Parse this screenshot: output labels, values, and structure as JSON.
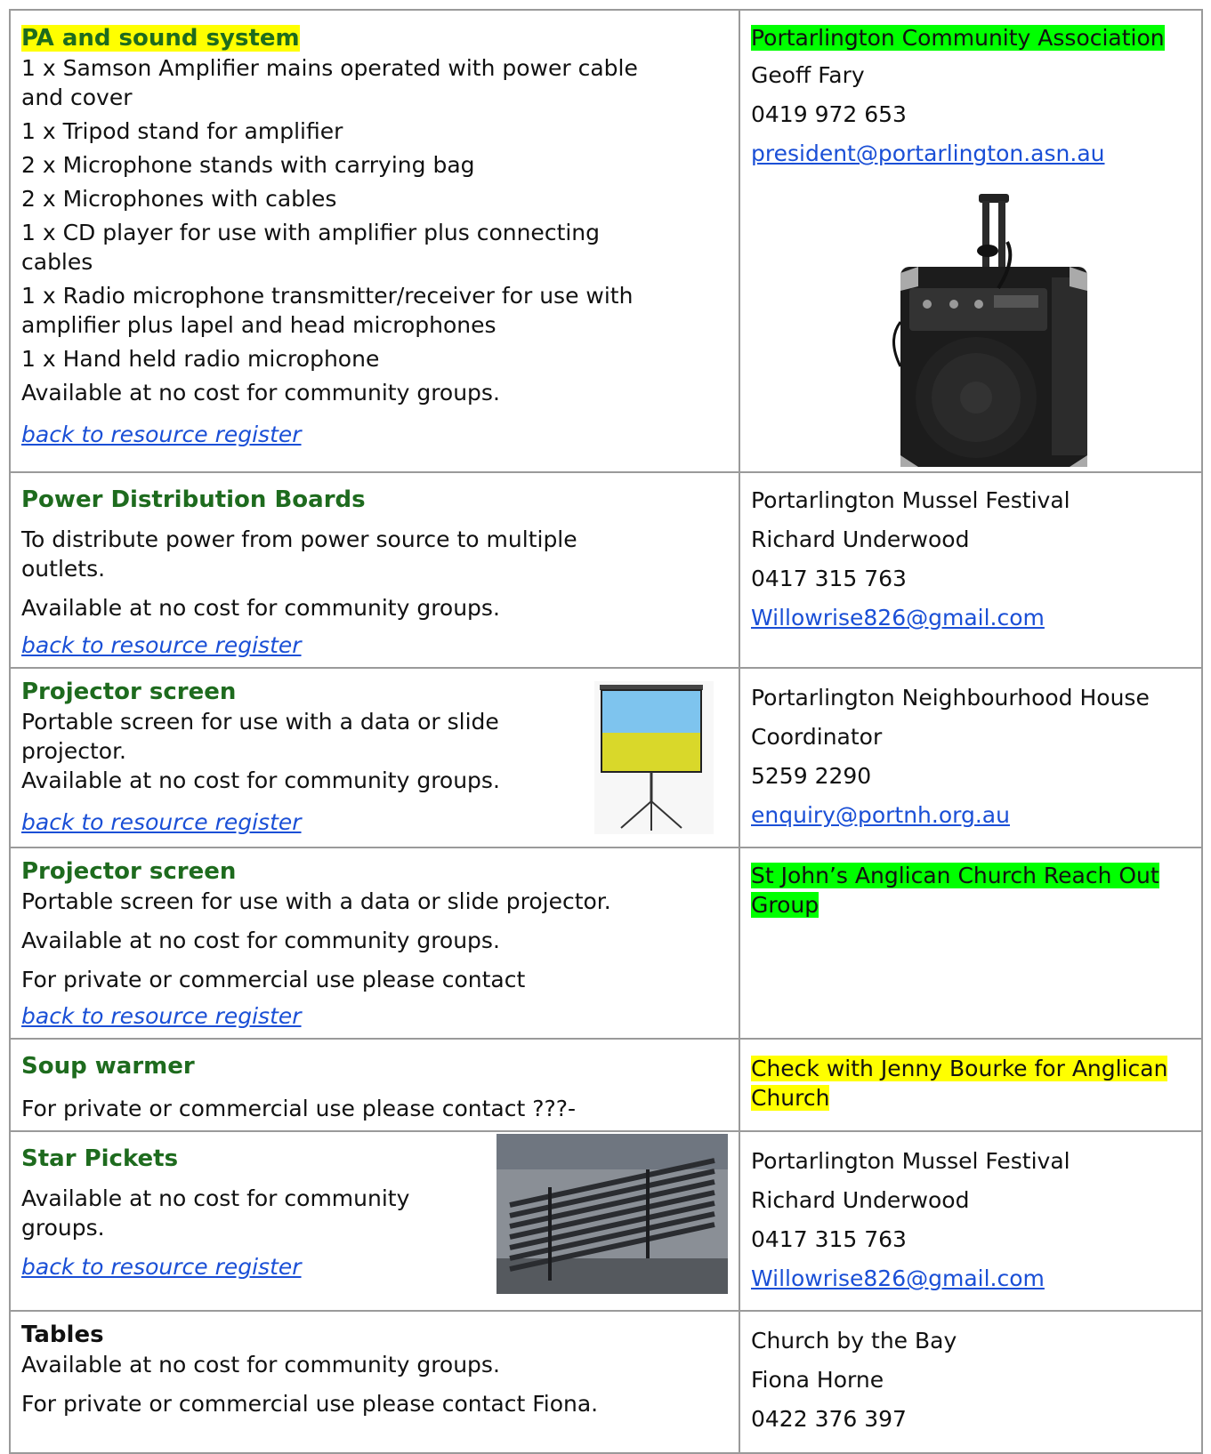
{
  "rows": [
    {
      "title": "PA and sound system",
      "lines": [
        "1 x Samson Amplifier mains operated with power cable and cover",
        "1 x Tripod stand for amplifier",
        "2 x Microphone stands with carrying bag",
        "2 x Microphones with cables",
        "1 x CD player for use with amplifier plus connecting cables",
        "1 x Radio microphone transmitter/receiver for use with amplifier plus lapel and head microphones",
        "1 x Hand held radio microphone",
        "Available at no cost for community groups."
      ],
      "link": "back to resource register",
      "org": "Portarlington Community Association",
      "contact": "Geoff Fary",
      "phone": "0419 972 653",
      "email": "president@portarlington.asn.au"
    },
    {
      "title": "Power Distribution Boards",
      "lines": [
        "To distribute power from power source to multiple outlets.",
        "Available at no cost for community groups."
      ],
      "link": "back to resource register",
      "org": "Portarlington Mussel Festival",
      "contact": "Richard Underwood",
      "phone": "0417 315 763",
      "email": "Willowrise826@gmail.com"
    },
    {
      "title": "Projector screen",
      "lines": [
        "Portable screen for use with a data or slide projector.",
        "Available at no cost for community groups."
      ],
      "link": "back to resource register",
      "org": "Portarlington Neighbourhood House",
      "contact": "Coordinator",
      "phone": "5259 2290",
      "email": "enquiry@portnh.org.au"
    },
    {
      "title": "Projector screen",
      "lines": [
        "Portable screen for use with a data or slide projector.",
        "Available at no cost for community groups.",
        "For private or commercial use please contact"
      ],
      "link": "back to resource register",
      "org": "St John’s Anglican Church Reach Out Group"
    },
    {
      "title": "Soup warmer",
      "lines": [
        "For private or commercial use please contact ???-"
      ],
      "org": "Check with Jenny Bourke for Anglican Church"
    },
    {
      "title": "Star Pickets",
      "lines": [
        "Available at no cost for community groups."
      ],
      "link": "back to resource register",
      "org": "Portarlington Mussel Festival",
      "contact": "Richard Underwood",
      "phone": "0417 315 763",
      "email": "Willowrise826@gmail.com"
    },
    {
      "title": "Tables",
      "lines": [
        "Available at no cost for community groups.",
        "For private or commercial use please contact Fiona."
      ],
      "org": "Church by the Bay",
      "contact": "Fiona Horne",
      "phone": "0422 376 397"
    }
  ],
  "colors": {
    "title_green": "#1e6b1e",
    "link_blue": "#1a4fd6",
    "highlight_yellow": "#ffff00",
    "highlight_green": "#00ff00",
    "border": "#9a9a9a"
  }
}
